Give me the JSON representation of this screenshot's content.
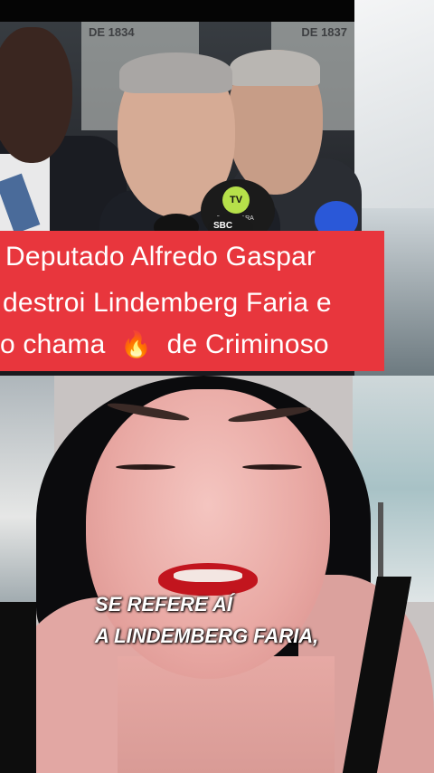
{
  "caption": {
    "line1": "Deputado Alfredo Gaspar",
    "line2": "destroi Lindemberg Faria e",
    "line3_prefix": "o chama",
    "line3_emoji": "🔥",
    "line3_suffix": "de Criminoso"
  },
  "subtitle": {
    "line1": "SE REFERE AÍ",
    "line2": "A LINDEMBERG FARIA,"
  },
  "mic_labels": {
    "tv_camara": "TV CÂMARA",
    "sbc": "SBC"
  },
  "poster_text": {
    "left": "DE 1834",
    "right": "DE 1837"
  },
  "colors": {
    "caption_bg": "#e8363d",
    "lips": "#c2151e"
  }
}
